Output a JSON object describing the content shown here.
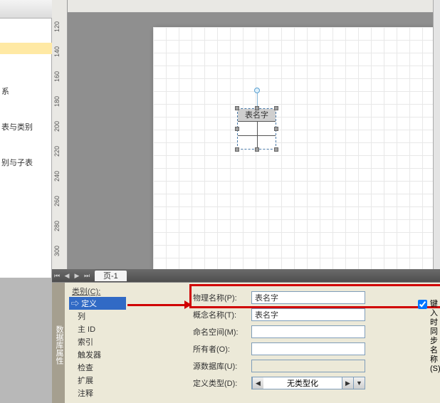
{
  "sidebar": {
    "items": [
      "系",
      "表与类别",
      "别与子表"
    ]
  },
  "ruler": {
    "v": [
      "300",
      "280",
      "260",
      "240",
      "220",
      "200",
      "180",
      "160",
      "140",
      "120"
    ]
  },
  "entity": {
    "title": "表名字"
  },
  "tabs": {
    "page": "页-1"
  },
  "props": {
    "vtab": "数据库属性",
    "cat_label": "类别(C):",
    "tree": {
      "root": "定义",
      "children": [
        "列",
        "主 ID",
        "索引",
        "触发器",
        "检查",
        "扩展",
        "注释"
      ]
    },
    "rows": {
      "phys_label": "物理名称(P):",
      "phys_value": "表名字",
      "concept_label": "概念名称(T):",
      "concept_value": "表名字",
      "ns_label": "命名空间(M):",
      "ns_value": "",
      "owner_label": "所有者(O):",
      "owner_value": "",
      "srcdb_label": "源数据库(U):",
      "srcdb_value": "",
      "deftype_label": "定义类型(D):",
      "deftype_value": "无类型化"
    },
    "sync": {
      "label_l1": "键入时同步",
      "label_l2": "名称(S)"
    }
  }
}
